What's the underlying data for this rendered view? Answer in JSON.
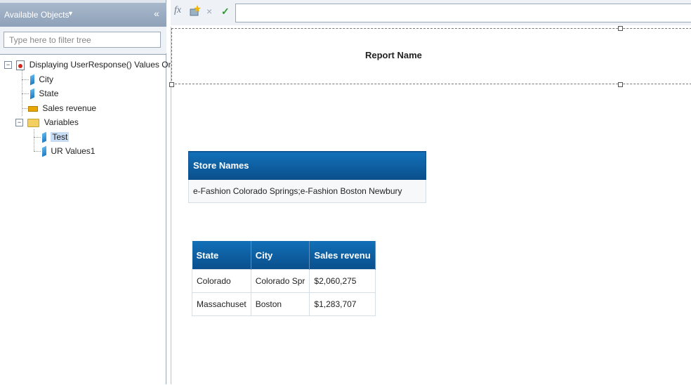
{
  "left_panel": {
    "header_title": "Available Objects",
    "collapse_glyph": "«",
    "filter_placeholder": "Type here to filter tree",
    "tree": {
      "root_label": "Displaying UserResponse() Values On S",
      "items": [
        {
          "label": "City",
          "icon": "dimension-icon"
        },
        {
          "label": "State",
          "icon": "dimension-icon"
        },
        {
          "label": "Sales revenue",
          "icon": "measure-icon"
        }
      ],
      "variables_folder": {
        "label": "Variables",
        "items": [
          {
            "label": "Test",
            "icon": "dimension-icon",
            "selected": true
          },
          {
            "label": "UR Values1",
            "icon": "dimension-icon"
          }
        ]
      }
    }
  },
  "toolbar": {
    "formula_editor_icon": "fx",
    "create_variable_icon": "variable-icon",
    "cancel_icon": "×",
    "validate_icon": "✓",
    "formula_value": ""
  },
  "report": {
    "report_name": "Report Name",
    "store_table": {
      "header": "Store Names",
      "value": "e-Fashion Colorado Springs;e-Fashion Boston Newbury"
    },
    "data_table": {
      "columns": [
        "State",
        "City",
        "Sales revenu"
      ],
      "rows": [
        [
          "Colorado",
          "Colorado Spr",
          "$2,060,275"
        ],
        [
          "Massachuset",
          "Boston",
          "$1,283,707"
        ]
      ]
    }
  },
  "colors": {
    "table_header": "#0a5fa3",
    "panel_header": "#97a9be"
  }
}
